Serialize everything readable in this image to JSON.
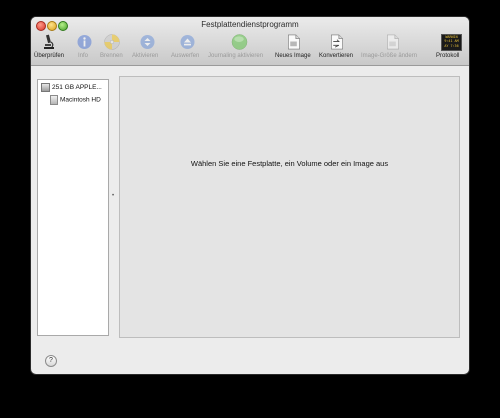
{
  "window": {
    "title": "Festplattendienstprogramm"
  },
  "toolbar": {
    "items": [
      {
        "label": "Überprüfen",
        "icon": "microscope-icon",
        "enabled": true
      },
      {
        "label": "Info",
        "icon": "info-icon",
        "enabled": false
      },
      {
        "label": "Brennen",
        "icon": "burn-icon",
        "enabled": false
      },
      {
        "label": "Aktivieren",
        "icon": "mount-icon",
        "enabled": false
      },
      {
        "label": "Auswerfen",
        "icon": "eject-icon",
        "enabled": false
      },
      {
        "label": "Journaling aktivieren",
        "icon": "journaling-icon",
        "enabled": false
      },
      {
        "label": "Neues Image",
        "icon": "new-image-icon",
        "enabled": true
      },
      {
        "label": "Konvertieren",
        "icon": "convert-icon",
        "enabled": true
      },
      {
        "label": "Image-Größe ändern",
        "icon": "resize-image-icon",
        "enabled": false
      },
      {
        "label": "Protokoll",
        "icon": "log-icon",
        "enabled": true
      }
    ],
    "log_icon_text": [
      "WARNIN",
      "9:41 AM",
      "AY 7:36"
    ]
  },
  "sidebar": {
    "items": [
      {
        "label": "251 GB APPLE...",
        "type": "disk"
      },
      {
        "label": "Macintosh HD",
        "type": "volume"
      }
    ]
  },
  "main": {
    "message": "Wählen Sie eine Festplatte, ein Volume oder ein Image aus"
  },
  "help": {
    "label": "?"
  }
}
